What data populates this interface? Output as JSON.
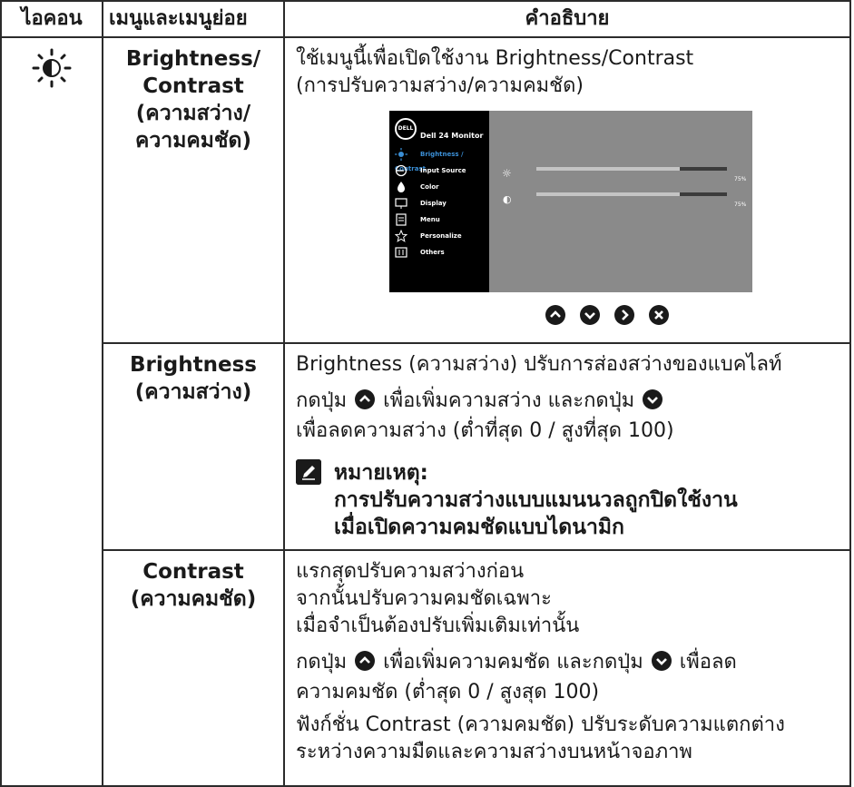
{
  "header": {
    "icon": "ไอคอน",
    "menu": "เมนูและเมนูย่อย",
    "description": "คำอธิบาย"
  },
  "rows": {
    "brightness_contrast": {
      "icon": "brightness-contrast-icon",
      "name_line1": "Brightness/",
      "name_line2": "Contrast",
      "name_line3": "(ความสว่าง/",
      "name_line4": "ความคมชัด)",
      "desc_line1": "ใช้เมนูนี้เพื่อเปิดใช้งาน Brightness/Contrast",
      "desc_line2": "(การปรับความสว่าง/ความคมชัด)"
    },
    "brightness": {
      "name_line1": "Brightness",
      "name_line2": "(ความสว่าง)",
      "desc_line1": "Brightness (ความสว่าง) ปรับการส่องสว่างของแบคไลท์",
      "desc_line2a": "กดปุ่ม",
      "desc_line2b": "เพื่อเพิ่มความสว่าง และกดปุ่ม",
      "desc_line3": "เพื่อลดความสว่าง (ต่ำที่สุด 0 / สูงที่สุด 100)",
      "note_title": "หมายเหตุ:",
      "note_line1": "การปรับความสว่างแบบแมนนวลถูกปิดใช้งาน",
      "note_line2": "เมื่อเปิดความคมชัดแบบไดนามิก"
    },
    "contrast": {
      "name_line1": "Contrast",
      "name_line2": "(ความคมชัด)",
      "desc_line1": "แรกสุดปรับความสว่างก่อน",
      "desc_line2": "จากนั้นปรับความคมชัดเฉพาะ",
      "desc_line3": "เมื่อจำเป็นต้องปรับเพิ่มเติมเท่านั้น",
      "desc_line4a": "กดปุ่ม",
      "desc_line4b": "เพื่อเพิ่มความคมชัด และกดปุ่ม",
      "desc_line4c": "เพื่อลด",
      "desc_line5": "ความคมชัด (ต่ำสุด 0 / สูงสุด 100)",
      "desc_line6": "ฟังก์ชั่น Contrast (ความคมชัด) ปรับระดับความแตกต่าง",
      "desc_line7": "ระหว่างความมืดและความสว่างบนหน้าจอภาพ"
    }
  },
  "osd": {
    "logo": "DELL",
    "title": "Dell 24 Monitor",
    "items": [
      {
        "label": "Brightness / Contrast",
        "icon": "brightness-icon",
        "active": true
      },
      {
        "label": "Input Source",
        "icon": "input-source-icon"
      },
      {
        "label": "Color",
        "icon": "color-icon"
      },
      {
        "label": "Display",
        "icon": "display-icon"
      },
      {
        "label": "Menu",
        "icon": "menu-icon"
      },
      {
        "label": "Personalize",
        "icon": "star-icon"
      },
      {
        "label": "Others",
        "icon": "others-icon"
      }
    ],
    "brightness_value": "75%",
    "contrast_value": "75%",
    "brightness_level": 0.75,
    "contrast_level": 0.75,
    "accent_color": "#3b8fd6",
    "nav_buttons": [
      "up-button-icon",
      "down-button-icon",
      "right-button-icon",
      "close-button-icon"
    ]
  }
}
